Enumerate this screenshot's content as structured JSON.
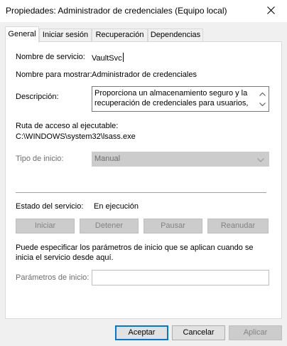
{
  "window": {
    "title": "Propiedades: Administrador de credenciales (Equipo local)",
    "close_icon": "close-icon"
  },
  "tabs": [
    {
      "label": "General",
      "active": true
    },
    {
      "label": "Iniciar sesión",
      "active": false
    },
    {
      "label": "Recuperación",
      "active": false
    },
    {
      "label": "Dependencias",
      "active": false
    }
  ],
  "general": {
    "service_name_label": "Nombre de servicio:",
    "service_name_value": "VaultSvc",
    "display_name_label": "Nombre para mostrar:",
    "display_name_value": "Administrador de credenciales",
    "description_label": "Descripción:",
    "description_value": "Proporciona un almacenamiento seguro y la recuperación de credenciales para usuarios,",
    "path_label": "Ruta de acceso al ejecutable:",
    "path_value": "C:\\WINDOWS\\system32\\lsass.exe",
    "startup_type_label": "Tipo de inicio:",
    "startup_type_value": "Manual",
    "status_label": "Estado del servicio:",
    "status_value": "En ejecución",
    "buttons": {
      "start": "Iniciar",
      "stop": "Detener",
      "pause": "Pausar",
      "resume": "Reanudar"
    },
    "params_hint": "Puede especificar los parámetros de inicio que se aplican cuando se inicia el servicio desde aquí.",
    "params_label": "Parámetros de inicio:",
    "params_value": ""
  },
  "footer": {
    "accept": "Aceptar",
    "cancel": "Cancelar",
    "apply": "Aplicar"
  }
}
